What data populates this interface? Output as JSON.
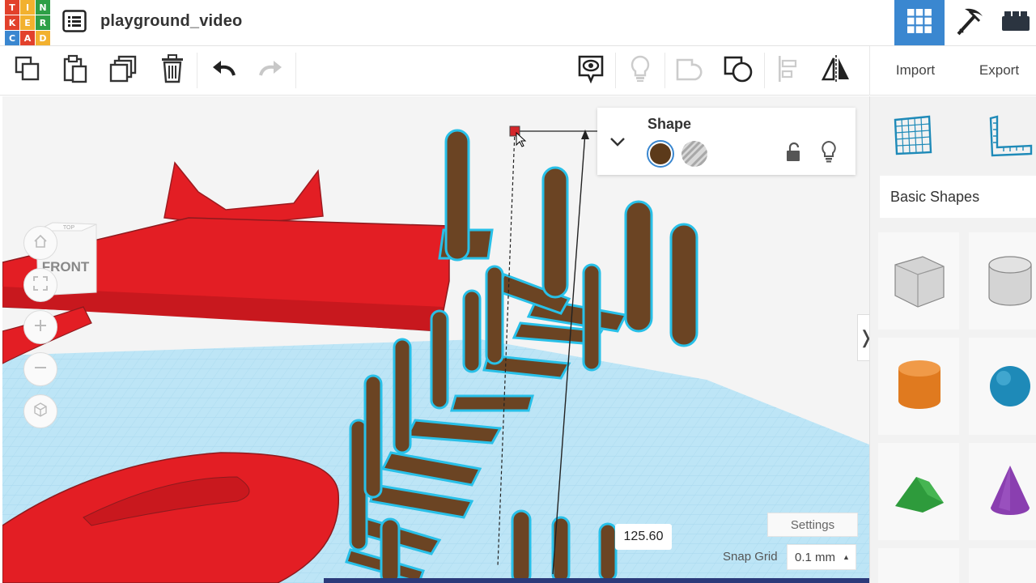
{
  "app": {
    "logo_letters": [
      "T",
      "I",
      "N",
      "K",
      "E",
      "R",
      "C",
      "A",
      "D"
    ],
    "logo_colors": [
      "#e2412c",
      "#f2b12f",
      "#2e9f47",
      "#e2412c",
      "#f2b12f",
      "#2e9f47",
      "#3a87d0",
      "#e2412c",
      "#f2b12f"
    ],
    "document_title": "playground_video",
    "accent_color": "#3a87d0"
  },
  "header": {
    "views": [
      {
        "name": "3d-design-view",
        "icon": "grid-icon",
        "active": true
      },
      {
        "name": "build-view",
        "icon": "pickaxe-icon",
        "active": false
      },
      {
        "name": "bricks-view",
        "icon": "brick-icon",
        "active": false
      }
    ]
  },
  "toolbar": {
    "left_tools": [
      "copy-icon",
      "paste-icon",
      "duplicate-icon",
      "delete-icon",
      "undo-icon",
      "redo-icon"
    ],
    "right_tools": [
      "notes-icon",
      "light-bulb-icon",
      "group-icon",
      "ungroup-icon",
      "align-icon",
      "mirror-icon"
    ],
    "import_label": "Import",
    "export_label": "Export"
  },
  "viewcube": {
    "face_label": "FRONT",
    "top_label": "TOP"
  },
  "nav_controls": [
    "home-view",
    "fit-all",
    "zoom-in",
    "zoom-out",
    "ortho-perspective"
  ],
  "inspector": {
    "title": "Shape",
    "solid_color": "#5c3a1a",
    "hole_label": "hole-swatch"
  },
  "library": {
    "category": "Basic Shapes",
    "top_items": [
      "workplane-icon",
      "ruler-icon"
    ],
    "shapes": [
      {
        "name": "box-hole",
        "color": "#c8c8c8"
      },
      {
        "name": "cylinder-hole",
        "color": "#c8c8c8"
      },
      {
        "name": "cylinder",
        "color": "#e07a1f"
      },
      {
        "name": "sphere",
        "color": "#1e8ab8"
      },
      {
        "name": "roof",
        "color": "#2e9b3c"
      },
      {
        "name": "cone",
        "color": "#8a3fb0"
      }
    ]
  },
  "viewport": {
    "dimension_value": "125.60",
    "settings_label": "Settings",
    "snap_grid_label": "Snap Grid",
    "snap_grid_value": "0.1 mm"
  },
  "scene_colors": {
    "workplane": "#b9e3f4",
    "red_shape": "#e31e24",
    "brown_shape": "#6b4423",
    "selection_outline": "#28c0e8"
  }
}
